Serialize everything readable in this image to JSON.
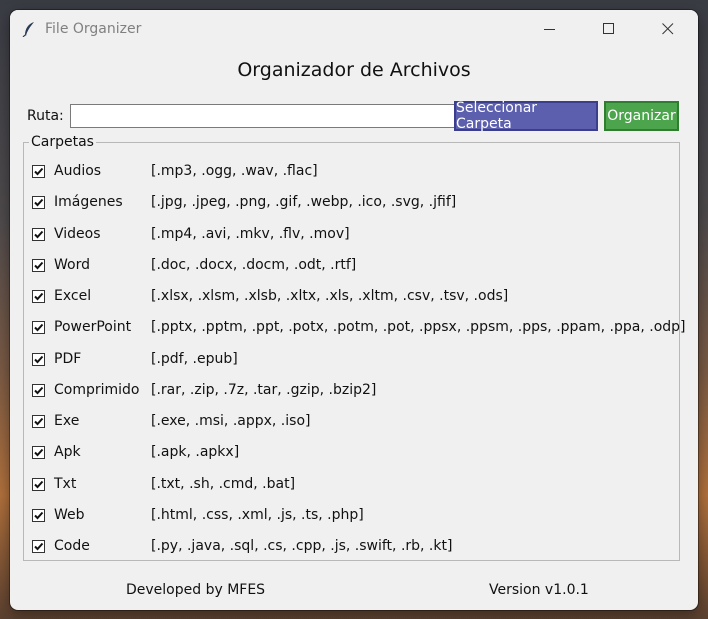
{
  "window": {
    "title": "File Organizer"
  },
  "header": {
    "title": "Organizador de Archivos"
  },
  "path_bar": {
    "label": "Ruta:",
    "value": "",
    "select_button": "Seleccionar Carpeta",
    "organize_button": "Organizar"
  },
  "folders": {
    "group_label": "Carpetas",
    "items": [
      {
        "label": "Audios",
        "extensions": "[.mp3, .ogg, .wav, .flac]",
        "checked": true
      },
      {
        "label": "Imágenes",
        "extensions": "[.jpg, .jpeg, .png, .gif, .webp, .ico, .svg, .jfif]",
        "checked": true
      },
      {
        "label": "Videos",
        "extensions": "[.mp4, .avi, .mkv, .flv, .mov]",
        "checked": true
      },
      {
        "label": "Word",
        "extensions": "[.doc, .docx, .docm, .odt, .rtf]",
        "checked": true
      },
      {
        "label": "Excel",
        "extensions": "[.xlsx, .xlsm, .xlsb, .xltx, .xls, .xltm, .csv, .tsv, .ods]",
        "checked": true
      },
      {
        "label": "PowerPoint",
        "extensions": "[.pptx, .pptm, .ppt, .potx, .potm, .pot, .ppsx, .ppsm, .pps, .ppam, .ppa, .odp]",
        "checked": true
      },
      {
        "label": "PDF",
        "extensions": "[.pdf, .epub]",
        "checked": true
      },
      {
        "label": "Comprimido",
        "extensions": "[.rar, .zip, .7z, .tar, .gzip, .bzip2]",
        "checked": true
      },
      {
        "label": "Exe",
        "extensions": "[.exe, .msi, .appx, .iso]",
        "checked": true
      },
      {
        "label": "Apk",
        "extensions": "[.apk, .apkx]",
        "checked": true
      },
      {
        "label": "Txt",
        "extensions": "[.txt, .sh, .cmd, .bat]",
        "checked": true
      },
      {
        "label": "Web",
        "extensions": "[.html, .css, .xml, .js, .ts, .php]",
        "checked": true
      },
      {
        "label": "Code",
        "extensions": "[.py, .java, .sql, .cs, .cpp, .js, .swift, .rb, .kt]",
        "checked": true
      }
    ]
  },
  "footer": {
    "developer": "Developed by MFES",
    "version": "Version v1.0.1"
  },
  "colors": {
    "select_button": "#5b5fae",
    "organize_button": "#4ca44c"
  },
  "icons": {
    "app": "feather-icon",
    "minimize": "minimize-icon",
    "maximize": "maximize-icon",
    "close": "close-icon",
    "check": "checkmark-icon"
  }
}
